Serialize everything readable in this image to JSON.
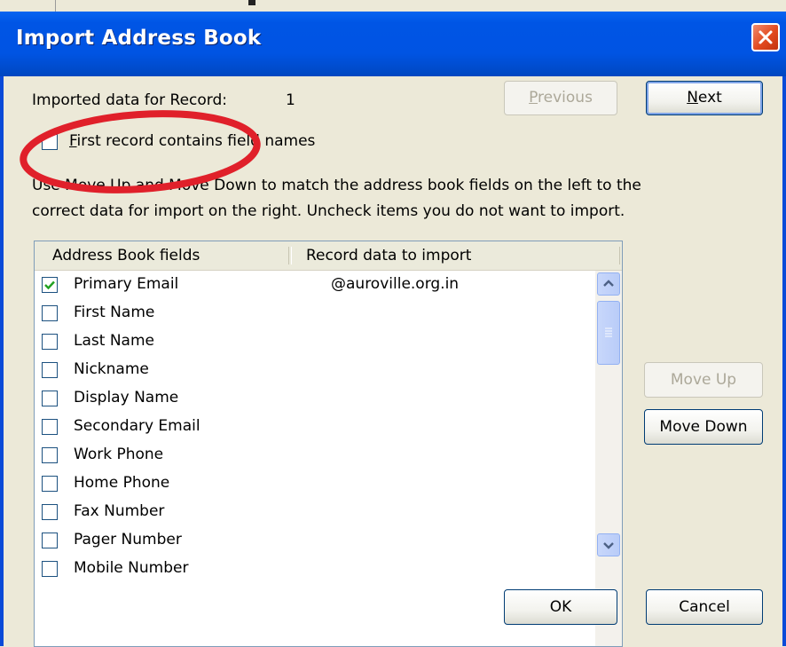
{
  "window": {
    "title": "Import Address Book"
  },
  "header": {
    "record_label": "Imported data for Record:",
    "record_number": "1"
  },
  "nav": {
    "previous_label": "Previous",
    "next_label": "Next"
  },
  "first_record_checkbox": {
    "label": "First record contains field names",
    "checked": false
  },
  "instructions": {
    "line1": "Use Move Up and Move Down to match the address book fields on the left to the",
    "line2": "correct data for import on the right. Uncheck items you do not want to import."
  },
  "list": {
    "columns": [
      "Address Book fields",
      "Record data to import"
    ],
    "rows": [
      {
        "field": "Primary Email",
        "value": "@auroville.org.in",
        "checked": true
      },
      {
        "field": "First Name",
        "value": "",
        "checked": false
      },
      {
        "field": "Last Name",
        "value": "",
        "checked": false
      },
      {
        "field": "Nickname",
        "value": "",
        "checked": false
      },
      {
        "field": "Display Name",
        "value": "",
        "checked": false
      },
      {
        "field": "Secondary Email",
        "value": "",
        "checked": false
      },
      {
        "field": "Work Phone",
        "value": "",
        "checked": false
      },
      {
        "field": "Home Phone",
        "value": "",
        "checked": false
      },
      {
        "field": "Fax Number",
        "value": "",
        "checked": false
      },
      {
        "field": "Pager Number",
        "value": "",
        "checked": false
      },
      {
        "field": "Mobile Number",
        "value": "",
        "checked": false
      }
    ]
  },
  "side_buttons": {
    "move_up_label": "Move Up",
    "move_down_label": "Move Down"
  },
  "footer": {
    "ok_label": "OK",
    "cancel_label": "Cancel"
  },
  "icons": {
    "close": "close-icon",
    "scroll_up": "chevron-up-icon",
    "scroll_down": "chevron-down-icon",
    "check": "checkmark-icon"
  },
  "colors": {
    "titlebar": "#0054E3",
    "dialog_bg": "#ECE9D8",
    "annotation": "#E0202A",
    "check": "#21A121"
  }
}
